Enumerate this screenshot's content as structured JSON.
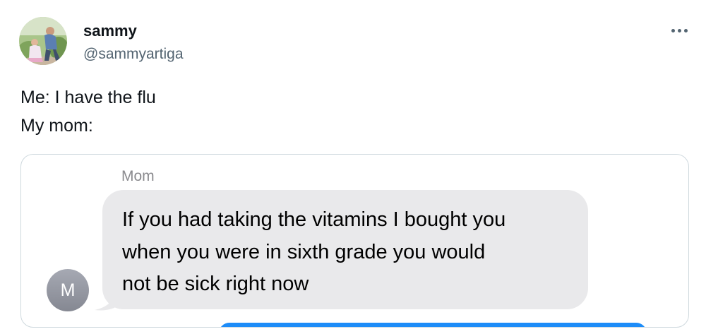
{
  "author": {
    "display_name": "sammy",
    "handle": "@sammyartiga",
    "avatar_icon": "profile-photo"
  },
  "more_icon": "more-options-icon",
  "tweet": {
    "lines": [
      "Me: I have the flu",
      "My mom:"
    ]
  },
  "screenshot": {
    "sender_name": "Mom",
    "contact_initial": "M",
    "message_lines": [
      "If you had taking the vitamins I bought you",
      "when you were in sixth grade you would",
      "not be sick right now"
    ]
  },
  "colors": {
    "primary_text": "#0f1419",
    "secondary_text": "#536471",
    "card_border": "#cfd9de",
    "received_bubble": "#e9e9eb",
    "sent_bubble": "#1d8cf8",
    "contact_avatar": "#9a9da6"
  }
}
